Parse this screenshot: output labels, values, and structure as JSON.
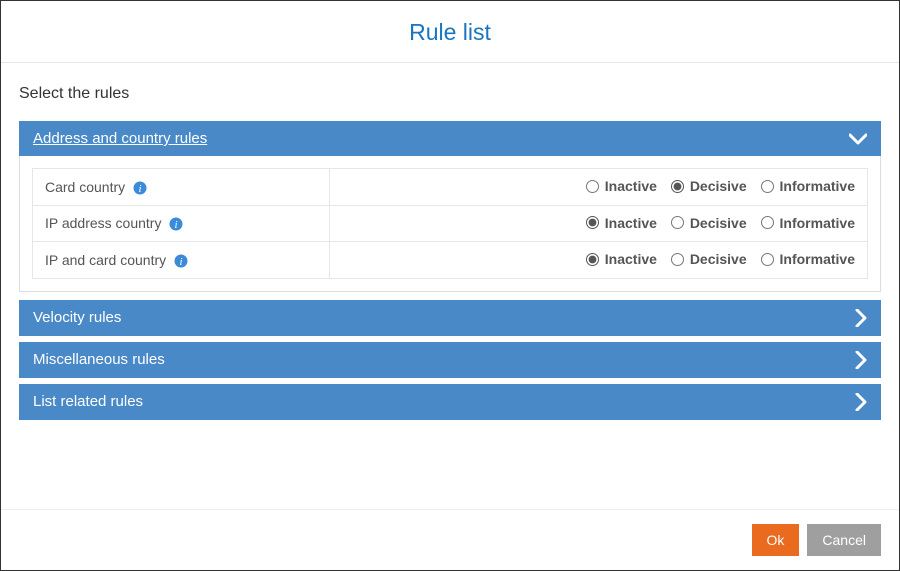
{
  "title": "Rule list",
  "subtitle": "Select the rules",
  "option_labels": {
    "inactive": "Inactive",
    "decisive": "Decisive",
    "informative": "Informative"
  },
  "sections": {
    "address": {
      "label": "Address and country rules",
      "expanded": true,
      "rules": [
        {
          "name": "Card country",
          "selected": "decisive"
        },
        {
          "name": "IP address country",
          "selected": "inactive"
        },
        {
          "name": "IP and card country",
          "selected": "inactive"
        }
      ]
    },
    "velocity": {
      "label": "Velocity rules",
      "expanded": false
    },
    "misc": {
      "label": "Miscellaneous rules",
      "expanded": false
    },
    "list": {
      "label": "List related rules",
      "expanded": false
    }
  },
  "buttons": {
    "ok": "Ok",
    "cancel": "Cancel"
  }
}
